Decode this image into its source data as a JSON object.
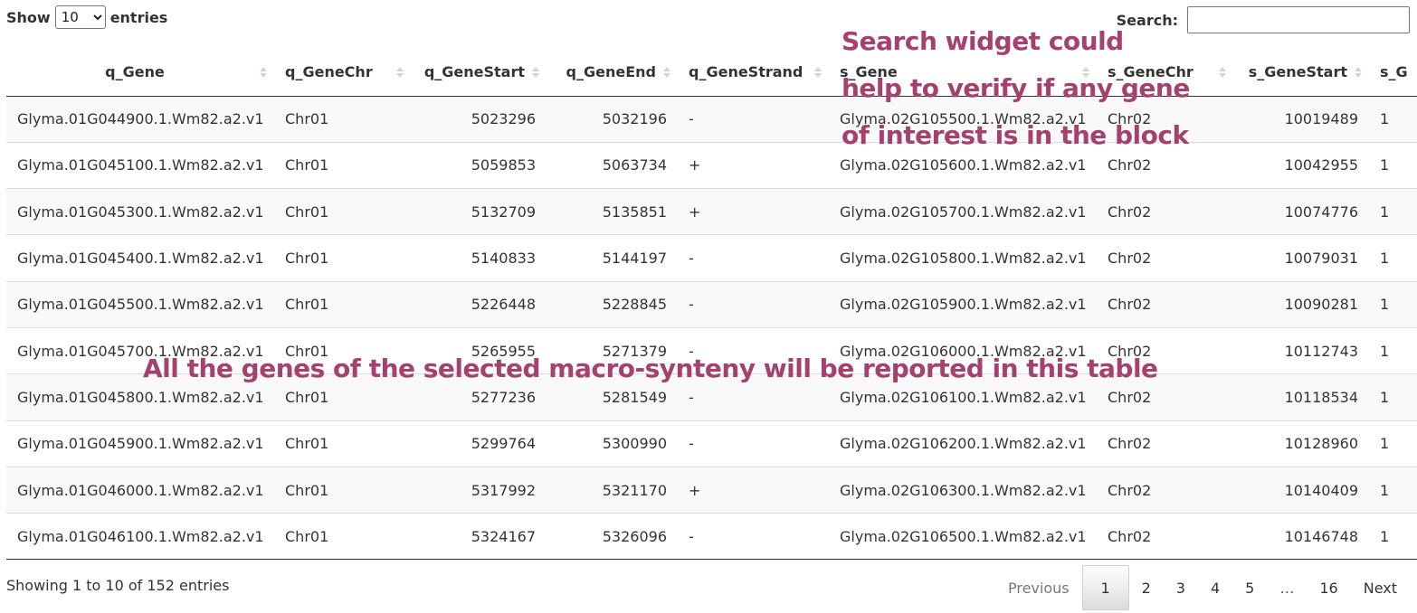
{
  "length_control": {
    "show_label": "Show",
    "selected": "10",
    "entries_label": "entries"
  },
  "search": {
    "label": "Search:",
    "value": ""
  },
  "table": {
    "columns": [
      {
        "label": "q_Gene",
        "align": "center"
      },
      {
        "label": "q_GeneChr",
        "align": "left"
      },
      {
        "label": "q_GeneStart",
        "align": "right"
      },
      {
        "label": "q_GeneEnd",
        "align": "right"
      },
      {
        "label": "q_GeneStrand",
        "align": "left"
      },
      {
        "label": "s_Gene",
        "align": "left"
      },
      {
        "label": "s_GeneChr",
        "align": "left"
      },
      {
        "label": "s_GeneStart",
        "align": "right"
      },
      {
        "label": "s_G",
        "align": "left"
      }
    ],
    "rows": [
      [
        "Glyma.01G044900.1.Wm82.a2.v1",
        "Chr01",
        "5023296",
        "5032196",
        "-",
        "Glyma.02G105500.1.Wm82.a2.v1",
        "Chr02",
        "10019489",
        "1"
      ],
      [
        "Glyma.01G045100.1.Wm82.a2.v1",
        "Chr01",
        "5059853",
        "5063734",
        "+",
        "Glyma.02G105600.1.Wm82.a2.v1",
        "Chr02",
        "10042955",
        "1"
      ],
      [
        "Glyma.01G045300.1.Wm82.a2.v1",
        "Chr01",
        "5132709",
        "5135851",
        "+",
        "Glyma.02G105700.1.Wm82.a2.v1",
        "Chr02",
        "10074776",
        "1"
      ],
      [
        "Glyma.01G045400.1.Wm82.a2.v1",
        "Chr01",
        "5140833",
        "5144197",
        "-",
        "Glyma.02G105800.1.Wm82.a2.v1",
        "Chr02",
        "10079031",
        "1"
      ],
      [
        "Glyma.01G045500.1.Wm82.a2.v1",
        "Chr01",
        "5226448",
        "5228845",
        "-",
        "Glyma.02G105900.1.Wm82.a2.v1",
        "Chr02",
        "10090281",
        "1"
      ],
      [
        "Glyma.01G045700.1.Wm82.a2.v1",
        "Chr01",
        "5265955",
        "5271379",
        "-",
        "Glyma.02G106000.1.Wm82.a2.v1",
        "Chr02",
        "10112743",
        "1"
      ],
      [
        "Glyma.01G045800.1.Wm82.a2.v1",
        "Chr01",
        "5277236",
        "5281549",
        "-",
        "Glyma.02G106100.1.Wm82.a2.v1",
        "Chr02",
        "10118534",
        "1"
      ],
      [
        "Glyma.01G045900.1.Wm82.a2.v1",
        "Chr01",
        "5299764",
        "5300990",
        "-",
        "Glyma.02G106200.1.Wm82.a2.v1",
        "Chr02",
        "10128960",
        "1"
      ],
      [
        "Glyma.01G046000.1.Wm82.a2.v1",
        "Chr01",
        "5317992",
        "5321170",
        "+",
        "Glyma.02G106300.1.Wm82.a2.v1",
        "Chr02",
        "10140409",
        "1"
      ],
      [
        "Glyma.01G046100.1.Wm82.a2.v1",
        "Chr01",
        "5324167",
        "5326096",
        "-",
        "Glyma.02G106500.1.Wm82.a2.v1",
        "Chr02",
        "10146748",
        "1"
      ]
    ]
  },
  "footer": {
    "info": "Showing 1 to 10 of 152 entries",
    "pagination": {
      "previous": "Previous",
      "pages": [
        "1",
        "2",
        "3",
        "4",
        "5",
        "…",
        "16"
      ],
      "current": "1",
      "next": "Next"
    }
  },
  "annotations": {
    "search_note": [
      "Search widget could",
      "help to verify if any gene",
      "of interest is in the block"
    ],
    "table_note": "All the genes of the selected macro-synteny will be reported in this table",
    "color": "#a5416f"
  }
}
